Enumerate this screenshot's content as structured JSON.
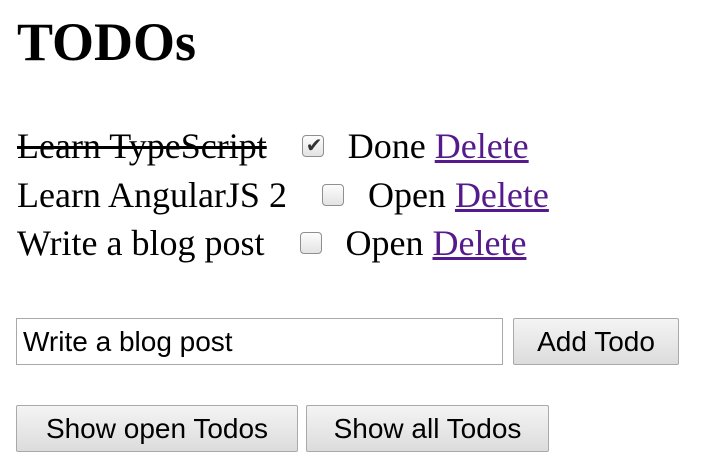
{
  "header": {
    "title": "TODOs"
  },
  "todos": [
    {
      "text": "Learn TypeScript",
      "done": true,
      "status": "Done",
      "delete_label": "Delete"
    },
    {
      "text": "Learn AngularJS 2",
      "done": false,
      "status": "Open",
      "delete_label": "Delete"
    },
    {
      "text": "Write a blog post",
      "done": false,
      "status": "Open",
      "delete_label": "Delete"
    }
  ],
  "add_form": {
    "input_value": "Write a blog post",
    "add_button_label": "Add Todo"
  },
  "filters": {
    "show_open_label": "Show open Todos",
    "show_all_label": "Show all Todos"
  },
  "colors": {
    "link": "#551a8b",
    "button_border": "#a9a9a9"
  },
  "icons": {
    "checkbox_checked": "checkmark-icon"
  }
}
